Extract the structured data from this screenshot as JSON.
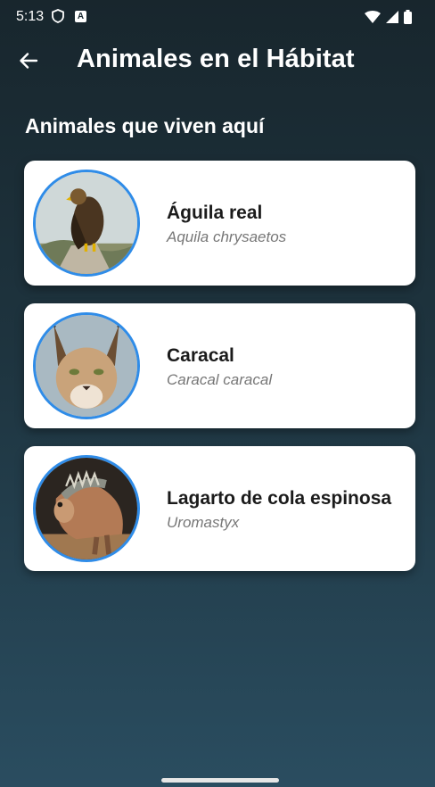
{
  "status_bar": {
    "time": "5:13",
    "a_badge": "A"
  },
  "app_bar": {
    "title": "Animales en el Hábitat",
    "back_icon": "arrow-left-icon"
  },
  "section": {
    "title": "Animales que viven aquí"
  },
  "animals": [
    {
      "name": "Águila real",
      "scientific": "Aquila chrysaetos",
      "image": "eagle-photo"
    },
    {
      "name": "Caracal",
      "scientific": "Caracal caracal",
      "image": "caracal-photo"
    },
    {
      "name": "Lagarto de cola espinosa",
      "scientific": "Uromastyx",
      "image": "iguana-photo"
    }
  ],
  "colors": {
    "accent_border": "#2f8ce8",
    "card_bg": "#ffffff",
    "bg_top": "#18262d",
    "bg_bottom": "#2a4d60"
  }
}
